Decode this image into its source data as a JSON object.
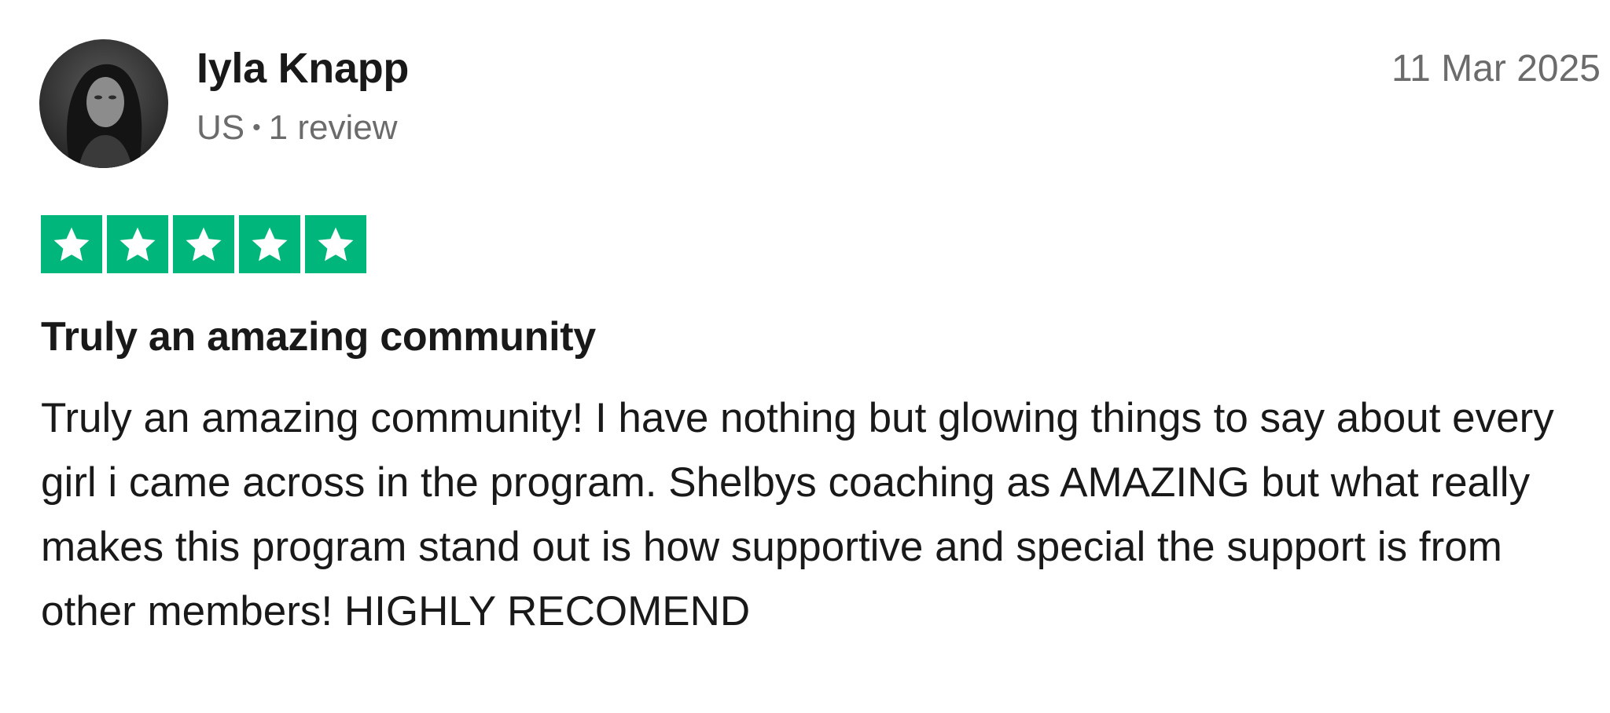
{
  "reviewer": {
    "name": "Iyla Knapp",
    "country": "US",
    "separator": "•",
    "review_count": "1 review"
  },
  "review": {
    "date": "11 Mar 2025",
    "rating": 5,
    "rating_max": 5,
    "star_color": "#00b67a",
    "title": "Truly an amazing community",
    "body": "Truly an amazing community! I have nothing but glowing things to say about every girl i came across in the program. Shelbys coaching as AMAZING but what really makes this program stand out is how supportive and special the support is from other members! HIGHLY RECOMEND"
  },
  "icons": {
    "avatar": "user-avatar-photo",
    "star": "star-icon"
  }
}
